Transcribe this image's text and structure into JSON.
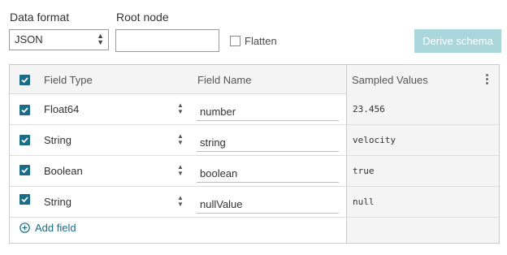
{
  "form": {
    "data_format_label": "Data format",
    "data_format_value": "JSON",
    "root_node_label": "Root node",
    "root_node_value": "",
    "flatten_label": "Flatten",
    "flatten_checked": false,
    "derive_button": "Derive schema"
  },
  "table": {
    "headers": {
      "field_type": "Field Type",
      "field_name": "Field Name",
      "sampled_values": "Sampled Values"
    },
    "select_all_checked": true,
    "rows": [
      {
        "checked": true,
        "type": "Float64",
        "name": "number",
        "sample": "23.456"
      },
      {
        "checked": true,
        "type": "String",
        "name": "string",
        "sample": "velocity"
      },
      {
        "checked": true,
        "type": "Boolean",
        "name": "boolean",
        "sample": "true"
      },
      {
        "checked": true,
        "type": "String",
        "name": "nullValue",
        "sample": "null"
      }
    ],
    "add_field_label": "Add field"
  },
  "icons": {
    "checkbox": "checkmark-icon",
    "select": "updown-chevron-icon",
    "menu": "kebab-menu-icon",
    "add": "plus-circle-icon"
  },
  "colors": {
    "accent": "#1d6c87",
    "derive_disabled": "#a9d6db",
    "header_bg": "#f4f4f4"
  }
}
